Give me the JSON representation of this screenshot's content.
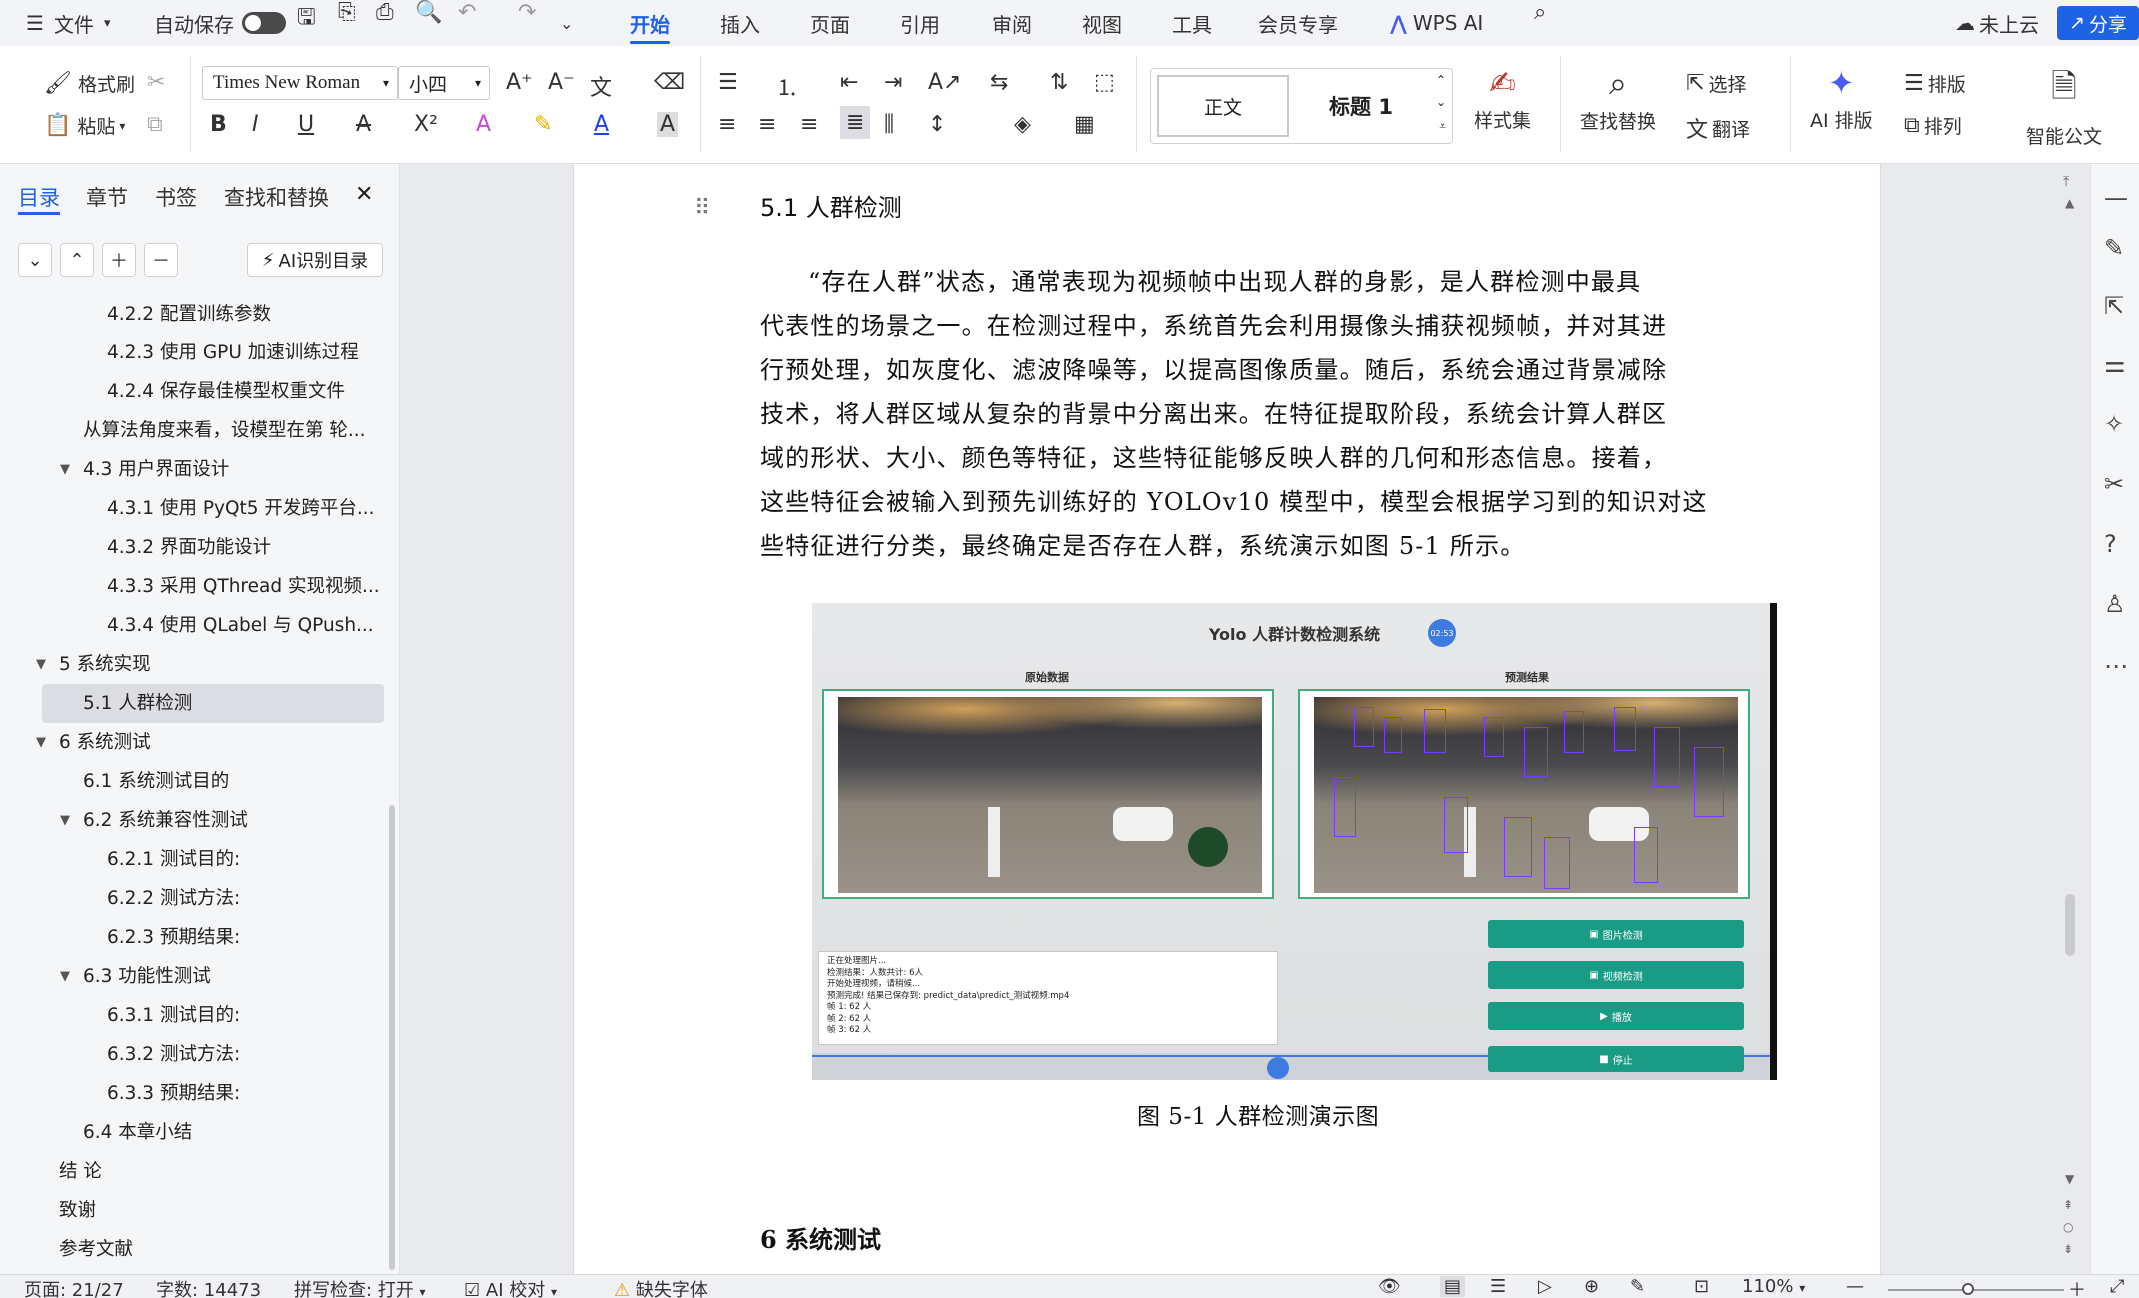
{
  "menubar": {
    "file_label": "文件",
    "autosave_label": "自动保存",
    "tabs": [
      "开始",
      "插入",
      "页面",
      "引用",
      "审阅",
      "视图",
      "工具",
      "会员专享",
      "WPS AI"
    ],
    "cloud_label": "未上云",
    "share_label": "分享"
  },
  "ribbon": {
    "format_painter": "格式刷",
    "paste": "粘贴",
    "font_name": "Times New Roman",
    "font_size": "小四",
    "style_normal": "正文",
    "style_heading1": "标题 1",
    "style_set": "样式集",
    "find_replace": "查找替换",
    "select": "选择",
    "translate": "翻译",
    "ai_layout": "AI 排版",
    "typeset": "排版",
    "arrange": "排列",
    "smart_doc": "智能公文"
  },
  "leftpanel": {
    "tabs": [
      "目录",
      "章节",
      "书签",
      "查找和替换"
    ],
    "ai_toc_button": "AI识别目录",
    "toc": [
      "4.2.2  配置训练参数",
      "4.2.3  使用 GPU 加速训练过程",
      "4.2.4  保存最佳模型权重文件",
      "从算法角度来看，设模型在第 轮...",
      "4.3 用户界面设计",
      "4.3.1  使用 PyQt5 开发跨平台...",
      "4.3.2  界面功能设计",
      "4.3.3  采用 QThread 实现视频...",
      "4.3.4  使用 QLabel 与 QPush...",
      "5 系统实现",
      "5.1 人群检测",
      "6  系统测试",
      "6.1  系统测试目的",
      "6.2  系统兼容性测试",
      "6.2.1 测试目的:",
      "6.2.2 测试方法:",
      "6.2.3 预期结果:",
      "6.3  功能性测试",
      "6.3.1 测试目的:",
      "6.3.2 测试方法:",
      "6.3.3 预期结果:",
      "6.4  本章小结",
      "结    论",
      "致谢",
      "参考文献"
    ]
  },
  "document": {
    "section_heading": "5.1 人群检测",
    "paragraph_lines": [
      "“存在人群”状态，通常表现为视频帧中出现人群的身影，是人群检测中最具",
      "代表性的场景之一。在检测过程中，系统首先会利用摄像头捕获视频帧，并对其进",
      "行预处理，如灰度化、滤波降噪等，以提高图像质量。随后，系统会通过背景减除",
      "技术，将人群区域从复杂的背景中分离出来。在特征提取阶段，系统会计算人群区",
      "域的形状、大小、颜色等特征，这些特征能够反映人群的几何和形态信息。接着，",
      "这些特征会被输入到预先训练好的 YOLOv10 模型中，模型会根据学习到的知识对这",
      "些特征进行分类，最终确定是否存在人群，系统演示如图 5-1 所示。"
    ],
    "figure_caption": "图 5-1  人群检测演示图",
    "next_heading": "6  系统测试"
  },
  "screenshot": {
    "title": "Yolo 人群计数检测系统",
    "timer": "02:53",
    "left_label": "原始数据",
    "right_label": "预测结果",
    "log_lines": [
      "正在处理图片...",
      "检测结果：人数共计: 6人",
      "开始处理视频，请稍候...",
      "预测完成! 结果已保存到: predict_data\\predict_测试视频.mp4",
      "帧 1: 62 人",
      "帧 2: 62 人",
      "帧 3: 62 人"
    ],
    "buttons": [
      "图片检测",
      "视频检测",
      "播放",
      "停止"
    ]
  },
  "statusbar": {
    "page": "页面: 21/27",
    "words": "字数: 14473",
    "spellcheck": "拼写检查: 打开",
    "ai_proof": "AI 校对",
    "missing_font": "缺失字体",
    "zoom": "110%"
  },
  "colors": {
    "accent": "#1e62e6",
    "green_button": "#1a9b86",
    "box_purple": "#7a3cff"
  }
}
